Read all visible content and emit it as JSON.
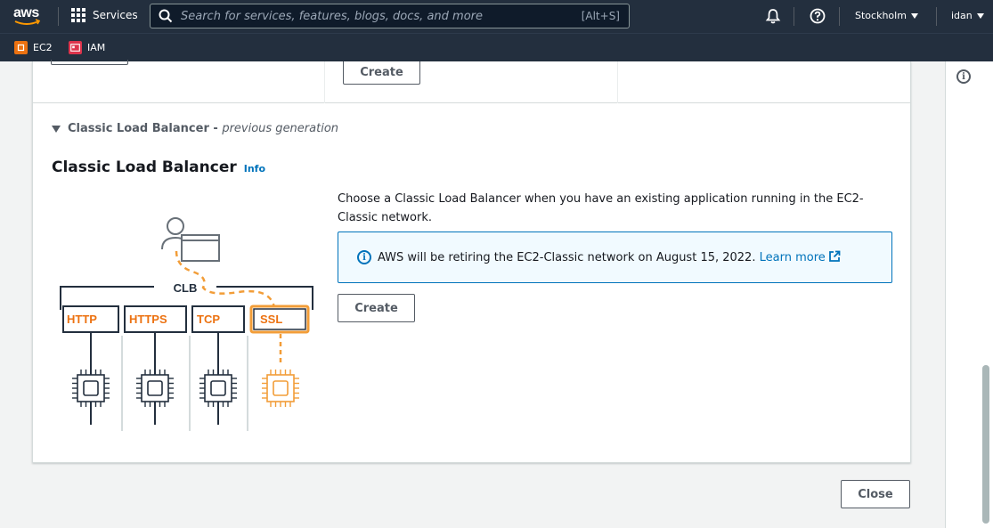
{
  "nav": {
    "logo_text": "aws",
    "services_label": "Services",
    "search_placeholder": "Search for services, features, blogs, docs, and more",
    "search_shortcut": "[Alt+S]",
    "region": "Stockholm",
    "user": "idan"
  },
  "favorites": [
    {
      "label": "EC2",
      "color": "#ec7211"
    },
    {
      "label": "IAM",
      "color": "#dd344c"
    }
  ],
  "upper": {
    "create_label": "Create"
  },
  "clb": {
    "section_label": "Classic Load Balancer",
    "section_sep": " - ",
    "section_suffix": "previous generation",
    "title": "Classic Load Balancer",
    "info_label": "Info",
    "description": "Choose a Classic Load Balancer when you have an existing application running in the EC2-Classic network.",
    "alert_text": "AWS will be retiring the EC2-Classic network on August 15, 2022.",
    "alert_link": "Learn more",
    "create_label": "Create",
    "diagram": {
      "clb_label": "CLB",
      "protocols": [
        "HTTP",
        "HTTPS",
        "TCP",
        "SSL"
      ]
    }
  },
  "footer": {
    "close_label": "Close"
  },
  "colors": {
    "nav_bg": "#232f3e",
    "link": "#0073bb",
    "accent_orange": "#ec7211",
    "diagram_orange": "#f29d38"
  }
}
